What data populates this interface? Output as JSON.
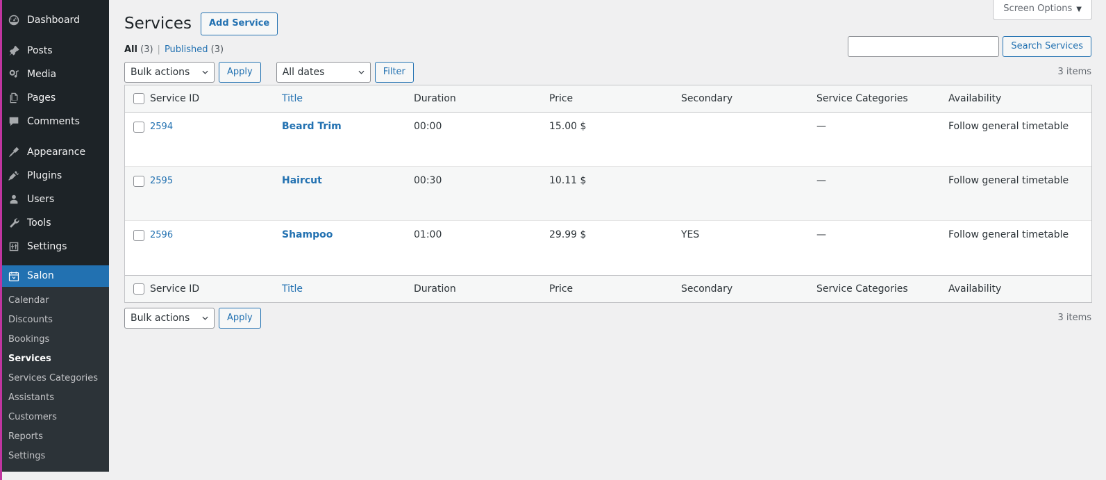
{
  "sidebar": {
    "primary": [
      {
        "label": "Dashboard",
        "icon": "dashboard-icon",
        "gap": false
      },
      {
        "label": "Posts",
        "icon": "pin-icon",
        "gap": true
      },
      {
        "label": "Media",
        "icon": "media-icon",
        "gap": false
      },
      {
        "label": "Pages",
        "icon": "pages-icon",
        "gap": false
      },
      {
        "label": "Comments",
        "icon": "comments-icon",
        "gap": false
      },
      {
        "label": "Appearance",
        "icon": "brush-icon",
        "gap": true
      },
      {
        "label": "Plugins",
        "icon": "plug-icon",
        "gap": false
      },
      {
        "label": "Users",
        "icon": "user-icon",
        "gap": false
      },
      {
        "label": "Tools",
        "icon": "wrench-icon",
        "gap": false
      },
      {
        "label": "Settings",
        "icon": "settings-icon",
        "gap": false
      }
    ],
    "current": {
      "label": "Salon",
      "icon": "calendar-icon"
    },
    "submenu": [
      {
        "label": "Calendar",
        "current": false
      },
      {
        "label": "Discounts",
        "current": false
      },
      {
        "label": "Bookings",
        "current": false
      },
      {
        "label": "Services",
        "current": true
      },
      {
        "label": "Services Categories",
        "current": false
      },
      {
        "label": "Assistants",
        "current": false
      },
      {
        "label": "Customers",
        "current": false
      },
      {
        "label": "Reports",
        "current": false
      },
      {
        "label": "Settings",
        "current": false
      }
    ]
  },
  "screen_options": {
    "label": "Screen Options",
    "caret": "▼"
  },
  "header": {
    "title": "Services",
    "add_button": "Add Service"
  },
  "views": {
    "all_label": "All",
    "all_count": "(3)",
    "divider": "|",
    "published_label": "Published",
    "published_count": "(3)"
  },
  "search": {
    "value": "",
    "placeholder": "",
    "button": "Search Services"
  },
  "tablenav_top": {
    "bulk_actions": "Bulk actions",
    "apply": "Apply",
    "dates": "All dates",
    "filter": "Filter",
    "items": "3 items"
  },
  "tablenav_bottom": {
    "bulk_actions": "Bulk actions",
    "apply": "Apply",
    "items": "3 items"
  },
  "table": {
    "columns": [
      {
        "key": "id",
        "label": "Service ID",
        "link": false
      },
      {
        "key": "title",
        "label": "Title",
        "link": true
      },
      {
        "key": "dur",
        "label": "Duration",
        "link": false
      },
      {
        "key": "price",
        "label": "Price",
        "link": false
      },
      {
        "key": "sec",
        "label": "Secondary",
        "link": false
      },
      {
        "key": "cat",
        "label": "Service Categories",
        "link": false
      },
      {
        "key": "avail",
        "label": "Availability",
        "link": false
      }
    ],
    "rows": [
      {
        "id": "2594",
        "title": "Beard Trim",
        "dur": "00:00",
        "price": "15.00 $",
        "sec": "",
        "cat": "—",
        "avail": "Follow general timetable"
      },
      {
        "id": "2595",
        "title": "Haircut",
        "dur": "00:30",
        "price": "10.11 $",
        "sec": "",
        "cat": "—",
        "avail": "Follow general timetable"
      },
      {
        "id": "2596",
        "title": "Shampoo",
        "dur": "01:00",
        "price": "29.99 $",
        "sec": "YES",
        "cat": "—",
        "avail": "Follow general timetable"
      }
    ]
  },
  "colors": {
    "sidebar_bg": "#1d2327",
    "submenu_bg": "#2c3338",
    "accent_blue": "#2271b1",
    "active_stripe": "#c035a0",
    "page_bg": "#f0f0f1",
    "row_alt": "#f6f7f7"
  }
}
